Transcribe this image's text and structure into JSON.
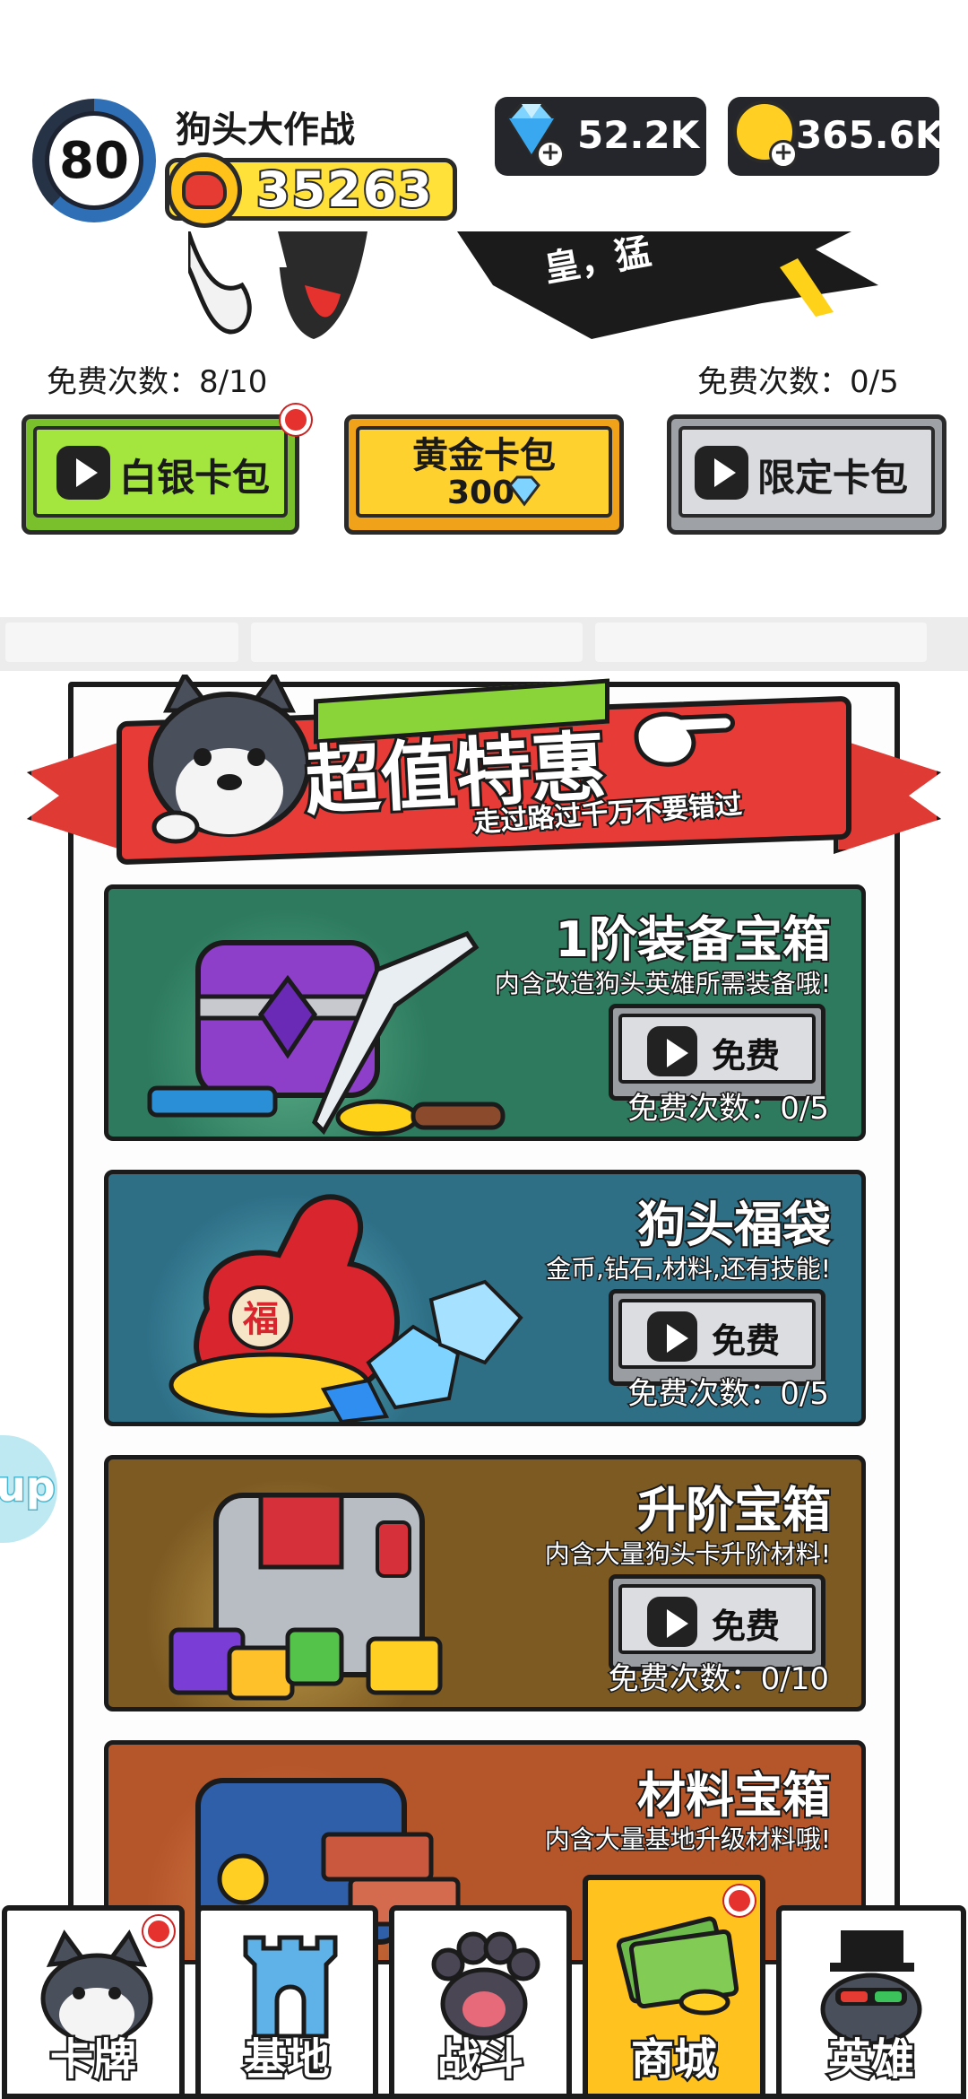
{
  "player": {
    "level": "80",
    "name": "狗头大作战",
    "power": "35263"
  },
  "currency": {
    "gems": "52.2K",
    "coins": "365.6K"
  },
  "banner_text": "皇，猛",
  "packs": {
    "free_left": "免费次数：8/10",
    "free_right": "免费次数：0/5",
    "silver_label": "白银卡包",
    "gold_label": "黄金卡包",
    "gold_price": "300",
    "limited_label": "限定卡包"
  },
  "deal": {
    "title": "超值特惠",
    "subtitle": "走过路过千万不要错过"
  },
  "cards": [
    {
      "title": "1阶装备宝箱",
      "desc": "内含改造狗头英雄所需装备哦!",
      "button": "免费",
      "free": "免费次数：0/5"
    },
    {
      "title": "狗头福袋",
      "desc": "金币,钻石,材料,还有技能!",
      "button": "免费",
      "free": "免费次数：0/5",
      "bag_char": "福"
    },
    {
      "title": "升阶宝箱",
      "desc": "内含大量狗头卡升阶材料!",
      "button": "免费",
      "free": "免费次数：0/10"
    },
    {
      "title": "材料宝箱",
      "desc": "内含大量基地升级材料哦!"
    }
  ],
  "side_pill": "up",
  "nav": [
    {
      "label": "卡牌",
      "icon": "husky-face-icon"
    },
    {
      "label": "基地",
      "icon": "castle-icon"
    },
    {
      "label": "战斗",
      "icon": "paw-icon"
    },
    {
      "label": "商城",
      "icon": "money-icon"
    },
    {
      "label": "英雄",
      "icon": "hero-hat-icon"
    }
  ],
  "colors": {
    "accent_red": "#e63b36",
    "silver_green": "#a4e63d",
    "gold_yellow": "#ffd12e",
    "nav_active": "#ffc21e"
  }
}
